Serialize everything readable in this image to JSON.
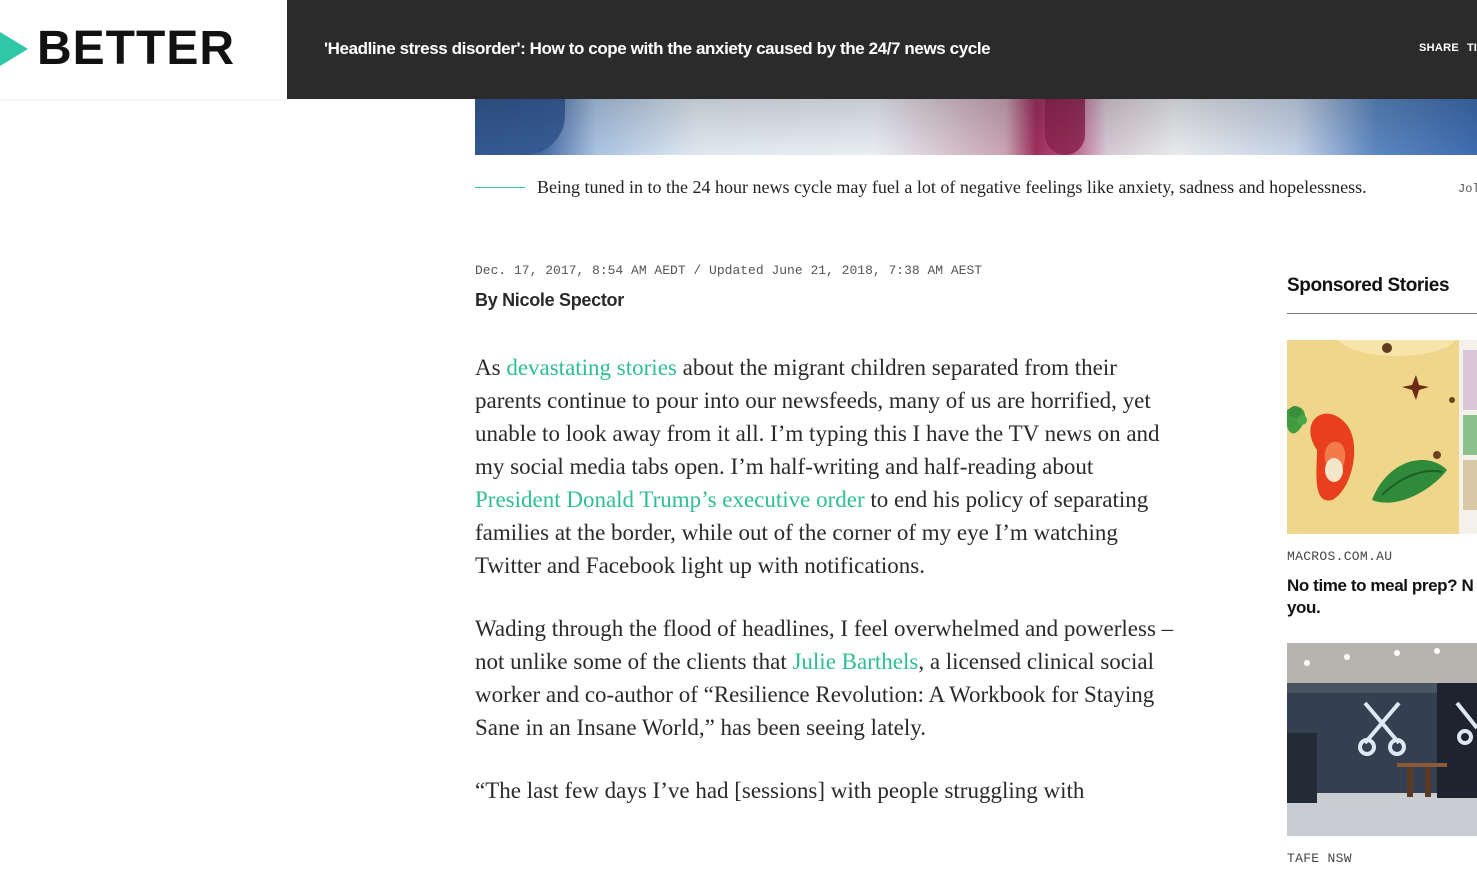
{
  "header": {
    "brand": "BETTER",
    "article_title": "'Headline stress disorder': How to cope with the anxiety caused by the 24/7 news cycle",
    "share_label": "SHARE",
    "next_label_partial": "TI"
  },
  "hero": {
    "caption": "Being tuned in to the 24 hour news cycle may fuel a lot of negative feelings like anxiety, sadness and hopelessness.",
    "credit_partial": "Jol"
  },
  "article": {
    "dateline": "Dec. 17, 2017, 8:54 AM AEDT / Updated June 21, 2018, 7:38 AM AEST",
    "byline": "By Nicole Spector",
    "p1": {
      "t1": "As ",
      "link1": "devastating stories",
      "t2": " about the migrant children separated from their parents continue to pour into our newsfeeds, many of us are horrified, yet unable to look away from it all. I’m typing this I have the TV news on and my social media tabs open. I’m half-writing and half-reading about ",
      "link2": "President Donald Trump’s executive order",
      "t3": " to end his policy of separating families at the border, while out of the corner of my eye I’m watching Twitter and Facebook light up with notifications."
    },
    "p2": {
      "t1": "Wading through the flood of headlines, I feel overwhelmed and powerless – not unlike some of the clients that ",
      "link1": "Julie Barthels",
      "t2": ", a licensed clinical social worker and co-author of “Resilience Revolution: A Workbook for Staying Sane in an Insane World,” has been seeing lately."
    },
    "p3": "“The last few days I’ve had [sessions] with people struggling with"
  },
  "sidebar": {
    "title": "Sponsored Stories",
    "cards": [
      {
        "source": "MACROS.COM.AU",
        "title": "No time to meal prep? N you."
      },
      {
        "source": "TAFE NSW"
      }
    ]
  },
  "colors": {
    "accent": "#2ec8a6",
    "link": "#2ebd95",
    "topbar": "#2b2b2b"
  }
}
